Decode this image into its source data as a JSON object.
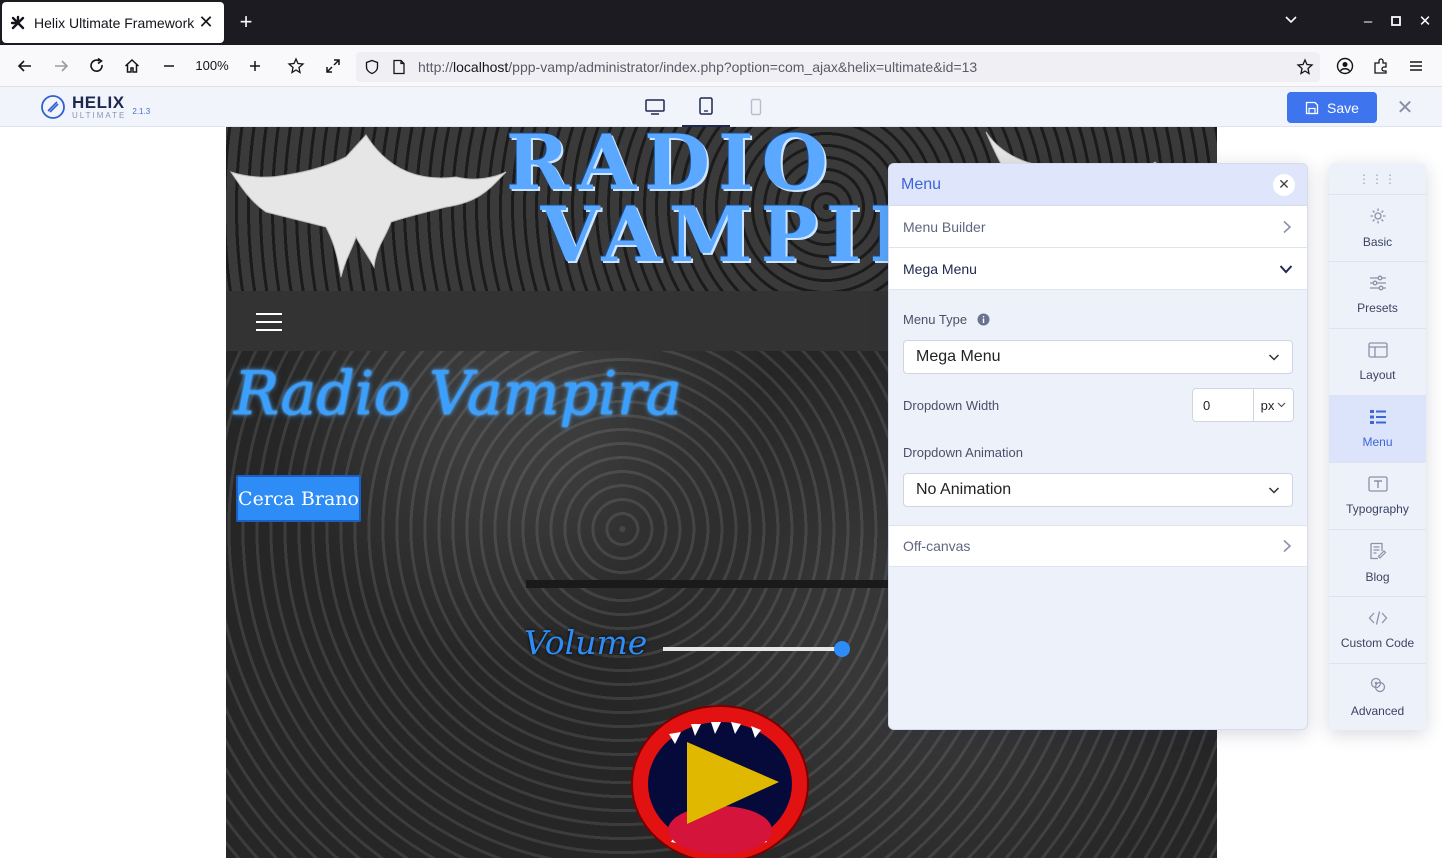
{
  "browser": {
    "tab_title": "Helix Ultimate Framework",
    "zoom": "100%",
    "url_prefix": "http://",
    "url_host": "localhost",
    "url_path": "/ppp-vamp/administrator/index.php?option=com_ajax&helix=ultimate&id=13"
  },
  "helix": {
    "name": "HELIX",
    "sub": "ULTIMATE",
    "version": "2.1.3",
    "save_label": "Save"
  },
  "site": {
    "title": "Radio Vampira",
    "search_label": "Cerca Brano",
    "volume_label": "Volume",
    "volume_level": 0.96
  },
  "panel": {
    "title": "Menu",
    "rows": [
      {
        "label": "Menu Builder"
      },
      {
        "label": "Mega Menu"
      },
      {
        "label": "Off-canvas"
      }
    ],
    "menu_type_label": "Menu Type",
    "menu_type_value": "Mega Menu",
    "dropdown_width_label": "Dropdown Width",
    "dropdown_width_value": "0",
    "dropdown_width_unit": "px",
    "dropdown_animation_label": "Dropdown Animation",
    "dropdown_animation_value": "No Animation"
  },
  "sidebar": {
    "items": [
      {
        "label": "Basic",
        "icon": "gear-icon"
      },
      {
        "label": "Presets",
        "icon": "sliders-icon"
      },
      {
        "label": "Layout",
        "icon": "layout-icon"
      },
      {
        "label": "Menu",
        "icon": "menu-list-icon",
        "active": true
      },
      {
        "label": "Typography",
        "icon": "typography-icon"
      },
      {
        "label": "Blog",
        "icon": "blog-icon"
      },
      {
        "label": "Custom Code",
        "icon": "code-icon"
      },
      {
        "label": "Advanced",
        "icon": "advanced-icon"
      }
    ]
  },
  "colors": {
    "accent": "#3e74ee",
    "panel_title": "#3e65d8",
    "site_blue": "#2e8cf6"
  }
}
